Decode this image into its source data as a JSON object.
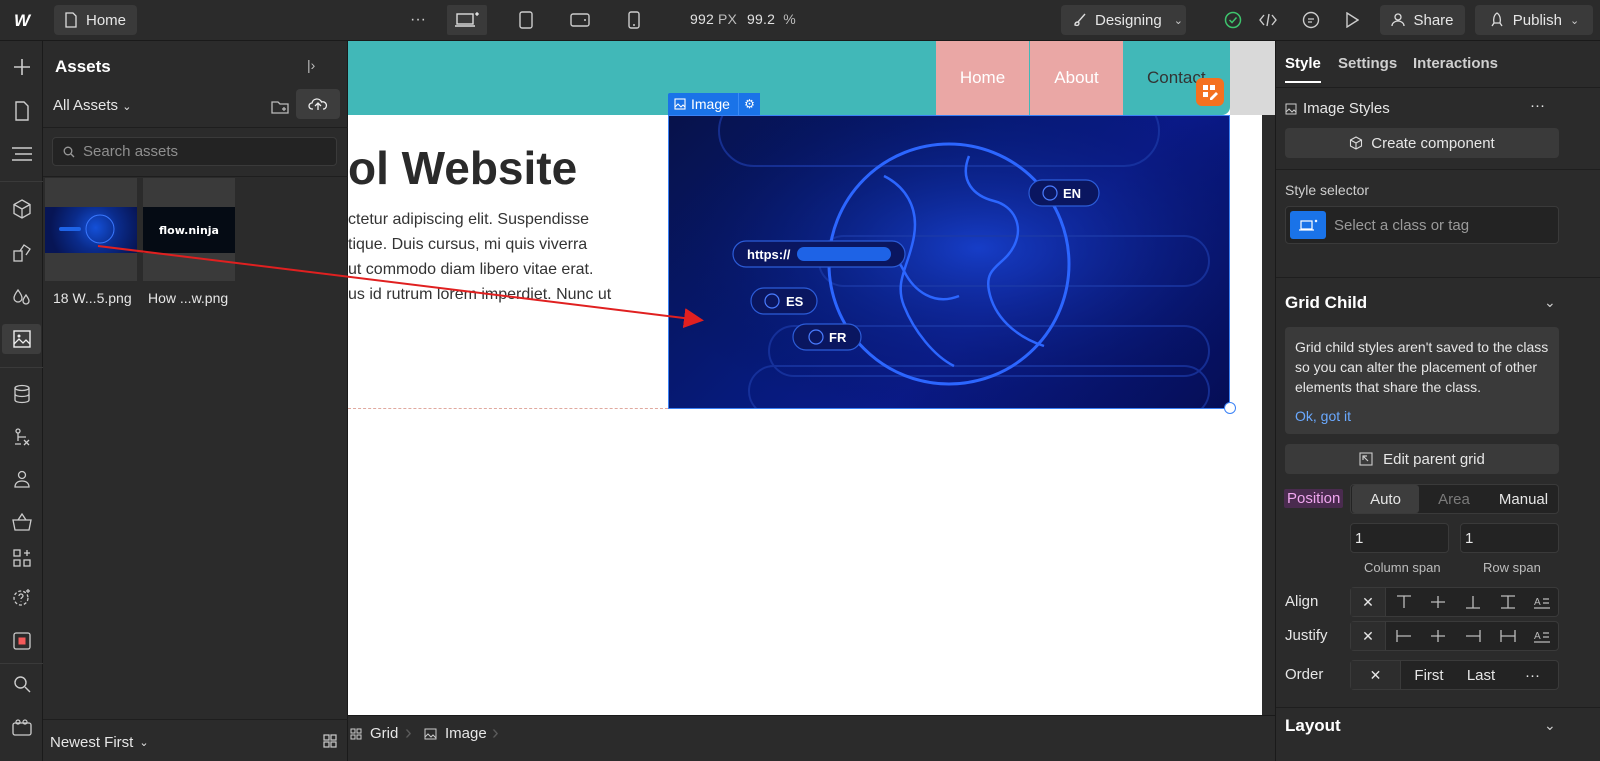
{
  "topbar": {
    "page_name": "Home",
    "more": "···",
    "width_value": "992",
    "width_unit": "PX",
    "zoom_value": "99.2",
    "zoom_unit": "%",
    "mode": "Designing",
    "share": "Share",
    "publish": "Publish"
  },
  "assets": {
    "title": "Assets",
    "filter": "All Assets",
    "search_placeholder": "Search assets",
    "items": [
      {
        "name": "18 W...5.png"
      },
      {
        "name": "How ...w.png"
      }
    ],
    "thumb2_text": "flow.ninja",
    "sort": "Newest First"
  },
  "canvas": {
    "nav": {
      "home": "Home",
      "about": "About",
      "contact": "Contact"
    },
    "heading": "ol Website",
    "body_lines": [
      "ctetur adipiscing elit. Suspendisse",
      "tique. Duis cursus, mi quis viverra",
      "ut commodo diam libero vitae erat.",
      "us id rutrum lorem imperdiet. Nunc ut"
    ],
    "image_tag": "Image",
    "image_labels": {
      "en": "EN",
      "https": "https://",
      "es": "ES",
      "fr": "FR"
    }
  },
  "breadcrumbs": {
    "grid": "Grid",
    "image": "Image"
  },
  "right": {
    "tabs": {
      "style": "Style",
      "settings": "Settings",
      "interactions": "Interactions"
    },
    "image_styles": "Image Styles",
    "create_component": "Create component",
    "style_selector": "Style selector",
    "selector_placeholder": "Select a class or tag",
    "grid_child": "Grid Child",
    "notice": "Grid child styles aren't saved to the class so you can alter the placement of other elements that share the class.",
    "notice_link": "Ok, got it",
    "edit_parent_grid": "Edit parent grid",
    "position": "Position",
    "position_options": {
      "auto": "Auto",
      "area": "Area",
      "manual": "Manual"
    },
    "column_span_value": "1",
    "row_span_value": "1",
    "column_span": "Column span",
    "row_span": "Row span",
    "align": "Align",
    "justify": "Justify",
    "order": "Order",
    "order_first": "First",
    "order_last": "Last",
    "order_more": "···",
    "layout": "Layout"
  },
  "colors": {
    "accent": "#1a73e8",
    "nav_teal": "#41b8b8",
    "nav_pink": "#eaa7a5",
    "annotation_arrow": "#e02020",
    "position_tag": "#f0a6ef"
  }
}
